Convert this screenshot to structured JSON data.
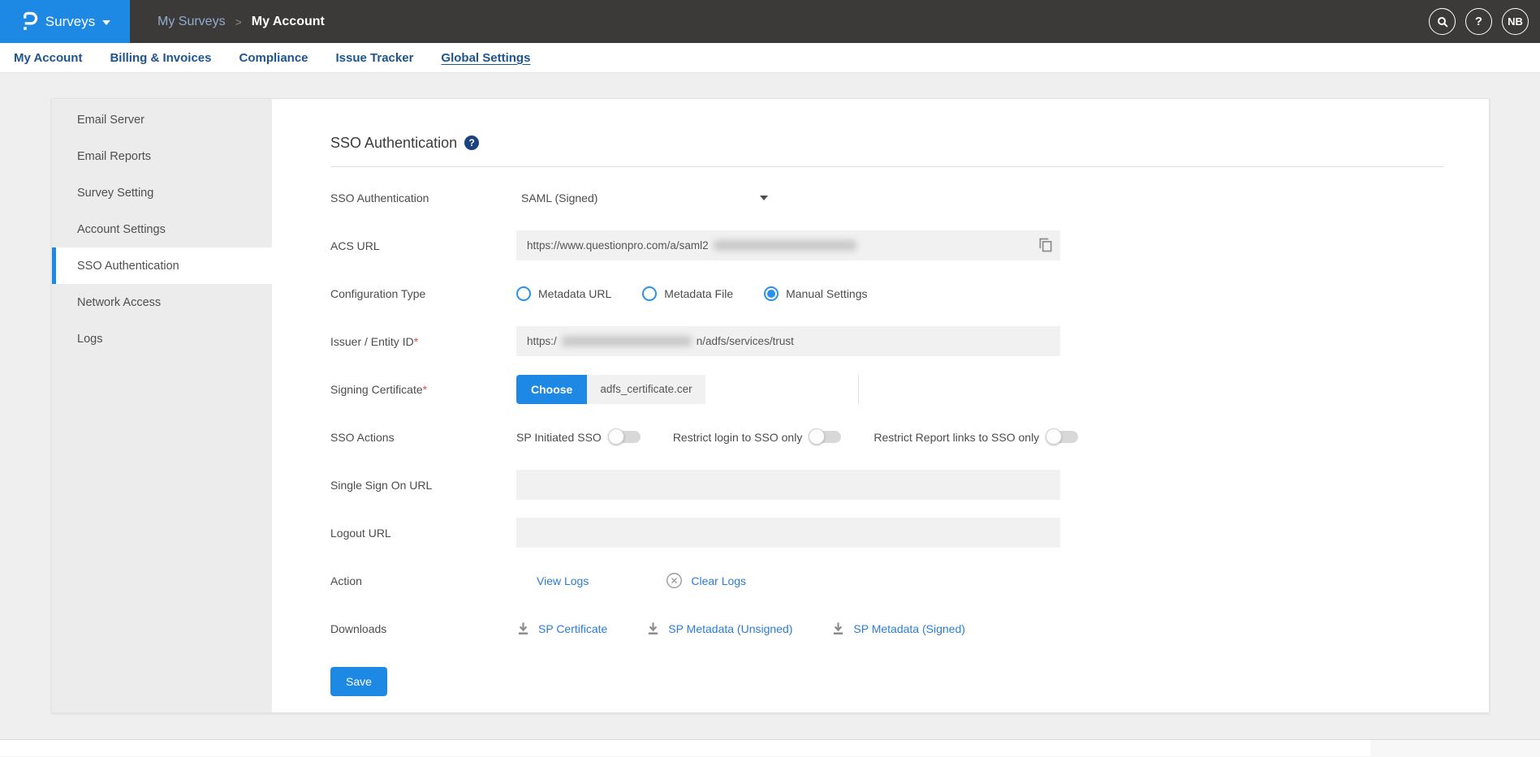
{
  "colors": {
    "accent": "#1e88e5",
    "link": "#2d7cd4",
    "header_bg": "#3b3a38",
    "title_help_bg": "#1c4280"
  },
  "header": {
    "product": "Surveys",
    "breadcrumb": {
      "parent": "My Surveys",
      "separator": ">",
      "current": "My Account"
    },
    "help_glyph": "?",
    "avatar_initials": "NB"
  },
  "tabs": [
    {
      "label": "My Account",
      "active": false
    },
    {
      "label": "Billing & Invoices",
      "active": false
    },
    {
      "label": "Compliance",
      "active": false
    },
    {
      "label": "Issue Tracker",
      "active": false
    },
    {
      "label": "Global Settings",
      "active": true
    }
  ],
  "sidebar": {
    "items": [
      {
        "label": "Email Server",
        "selected": false
      },
      {
        "label": "Email Reports",
        "selected": false
      },
      {
        "label": "Survey Setting",
        "selected": false
      },
      {
        "label": "Account Settings",
        "selected": false
      },
      {
        "label": "SSO Authentication",
        "selected": true
      },
      {
        "label": "Network Access",
        "selected": false
      },
      {
        "label": "Logs",
        "selected": false
      }
    ]
  },
  "form": {
    "title": "SSO Authentication",
    "title_help_glyph": "?",
    "sso_type": {
      "label": "SSO Authentication",
      "value": "SAML (Signed)"
    },
    "acs_url": {
      "label": "ACS URL",
      "value": "https://www.questionpro.com/a/saml2"
    },
    "config_type": {
      "label": "Configuration Type",
      "options": [
        {
          "label": "Metadata URL",
          "selected": false
        },
        {
          "label": "Metadata File",
          "selected": false
        },
        {
          "label": "Manual Settings",
          "selected": true
        }
      ]
    },
    "issuer": {
      "label": "Issuer / Entity ID",
      "required_mark": "*",
      "value_prefix": "https:/",
      "value_suffix": "n/adfs/services/trust"
    },
    "signing_certificate": {
      "label": "Signing Certificate",
      "required_mark": "*",
      "button_label": "Choose",
      "filename": "adfs_certificate.cer"
    },
    "sso_actions": {
      "label": "SSO Actions",
      "toggles": [
        {
          "label": "SP Initiated SSO",
          "on": false
        },
        {
          "label": "Restrict login to SSO only",
          "on": false
        },
        {
          "label": "Restrict Report links to SSO only",
          "on": false
        }
      ]
    },
    "single_sign_on_url": {
      "label": "Single Sign On URL",
      "value": ""
    },
    "logout_url": {
      "label": "Logout URL",
      "value": ""
    },
    "action": {
      "label": "Action",
      "view_logs": "View Logs",
      "clear_logs": "Clear Logs"
    },
    "downloads": {
      "label": "Downloads",
      "links": [
        {
          "label": "SP Certificate"
        },
        {
          "label": "SP Metadata (Unsigned)"
        },
        {
          "label": "SP Metadata (Signed)"
        }
      ]
    },
    "save_label": "Save"
  }
}
